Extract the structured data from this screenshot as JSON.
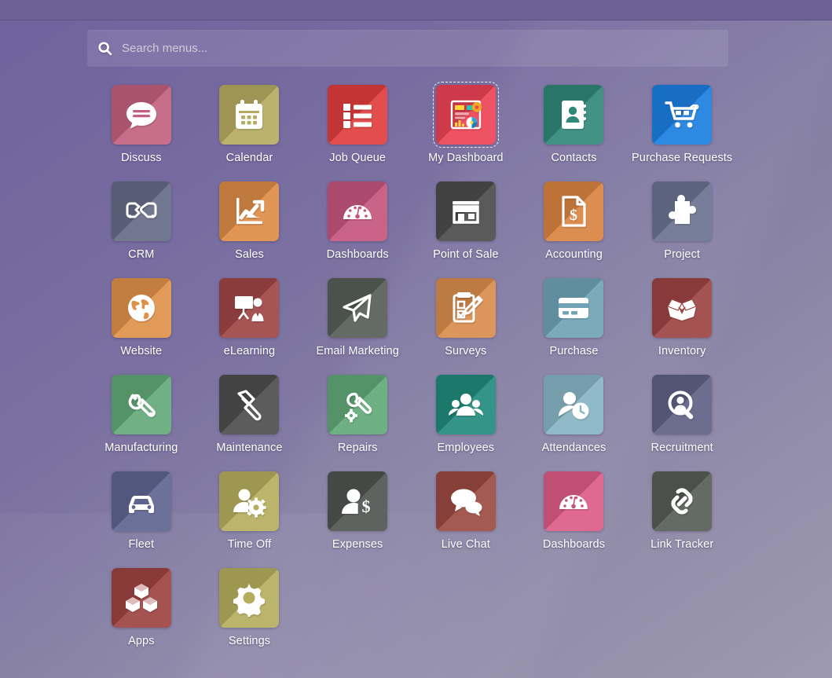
{
  "window": {
    "topbar_color": "#6d6198",
    "background_from": "#6f639e",
    "background_to": "#9d99b0"
  },
  "search": {
    "placeholder": "Search menus...",
    "value": "",
    "icon": "search-icon"
  },
  "apps": [
    {
      "label": "Discuss",
      "icon": "comment-bubble-icon",
      "color": "#c2607f",
      "selected": false
    },
    {
      "label": "Calendar",
      "icon": "calendar-icon",
      "color": "#b5ab61",
      "selected": false
    },
    {
      "label": "Job Queue",
      "icon": "list-bullets-icon",
      "color": "#e03c3c",
      "selected": false
    },
    {
      "label": "My Dashboard",
      "icon": "dashboard-report-icon",
      "color": "#ec4254",
      "selected": true
    },
    {
      "label": "Contacts",
      "icon": "address-book-icon",
      "color": "#2f8878",
      "selected": false
    },
    {
      "label": "Purchase Requests",
      "icon": "shopping-cart-icon",
      "color": "#1a7ee0",
      "selected": false
    },
    {
      "label": "CRM",
      "icon": "handshake-icon",
      "color": "#646b85",
      "selected": false
    },
    {
      "label": "Sales",
      "icon": "growth-chart-icon",
      "color": "#dd8b45",
      "selected": false
    },
    {
      "label": "Dashboards",
      "icon": "gauge-icon",
      "color": "#c4557d",
      "selected": false
    },
    {
      "label": "Point of Sale",
      "icon": "storefront-icon",
      "color": "#4b4b4b",
      "selected": false
    },
    {
      "label": "Accounting",
      "icon": "invoice-dollar-icon",
      "color": "#d9833f",
      "selected": false
    },
    {
      "label": "Project",
      "icon": "puzzle-piece-icon",
      "color": "#6a7290",
      "selected": false
    },
    {
      "label": "Website",
      "icon": "globe-icon",
      "color": "#df9049",
      "selected": false
    },
    {
      "label": "eLearning",
      "icon": "presentation-icon",
      "color": "#9e4444",
      "selected": false
    },
    {
      "label": "Email Marketing",
      "icon": "paper-plane-icon",
      "color": "#565d56",
      "selected": false
    },
    {
      "label": "Surveys",
      "icon": "clipboard-pencil-icon",
      "color": "#d98c4c",
      "selected": false
    },
    {
      "label": "Purchase",
      "icon": "credit-card-icon",
      "color": "#6fa3b5",
      "selected": false
    },
    {
      "label": "Inventory",
      "icon": "open-box-icon",
      "color": "#9c4343",
      "selected": false
    },
    {
      "label": "Manufacturing",
      "icon": "wrench-icon",
      "color": "#62a878",
      "selected": false
    },
    {
      "label": "Maintenance",
      "icon": "hammer-icon",
      "color": "#4d4d4d",
      "selected": false
    },
    {
      "label": "Repairs",
      "icon": "wrench-gear-icon",
      "color": "#61a877",
      "selected": false
    },
    {
      "label": "Employees",
      "icon": "people-group-icon",
      "color": "#218a7c",
      "selected": false
    },
    {
      "label": "Attendances",
      "icon": "person-clock-icon",
      "color": "#87b4c4",
      "selected": false
    },
    {
      "label": "Recruitment",
      "icon": "person-search-icon",
      "color": "#5f5f86",
      "selected": false
    },
    {
      "label": "Fleet",
      "icon": "car-icon",
      "color": "#5e6490",
      "selected": false
    },
    {
      "label": "Time Off",
      "icon": "person-gear-icon",
      "color": "#b6ad5d",
      "selected": false
    },
    {
      "label": "Expenses",
      "icon": "person-dollar-icon",
      "color": "#4f5450",
      "selected": false
    },
    {
      "label": "Live Chat",
      "icon": "chat-bubbles-icon",
      "color": "#9b4a41",
      "selected": false
    },
    {
      "label": "Dashboards",
      "icon": "gauge-icon",
      "color": "#dc5b86",
      "selected": false
    },
    {
      "label": "Link Tracker",
      "icon": "chain-link-icon",
      "color": "#565c55",
      "selected": false
    },
    {
      "label": "Apps",
      "icon": "boxes-icon",
      "color": "#9c4340",
      "selected": false
    },
    {
      "label": "Settings",
      "icon": "gear-icon",
      "color": "#b5ad5e",
      "selected": false
    }
  ]
}
